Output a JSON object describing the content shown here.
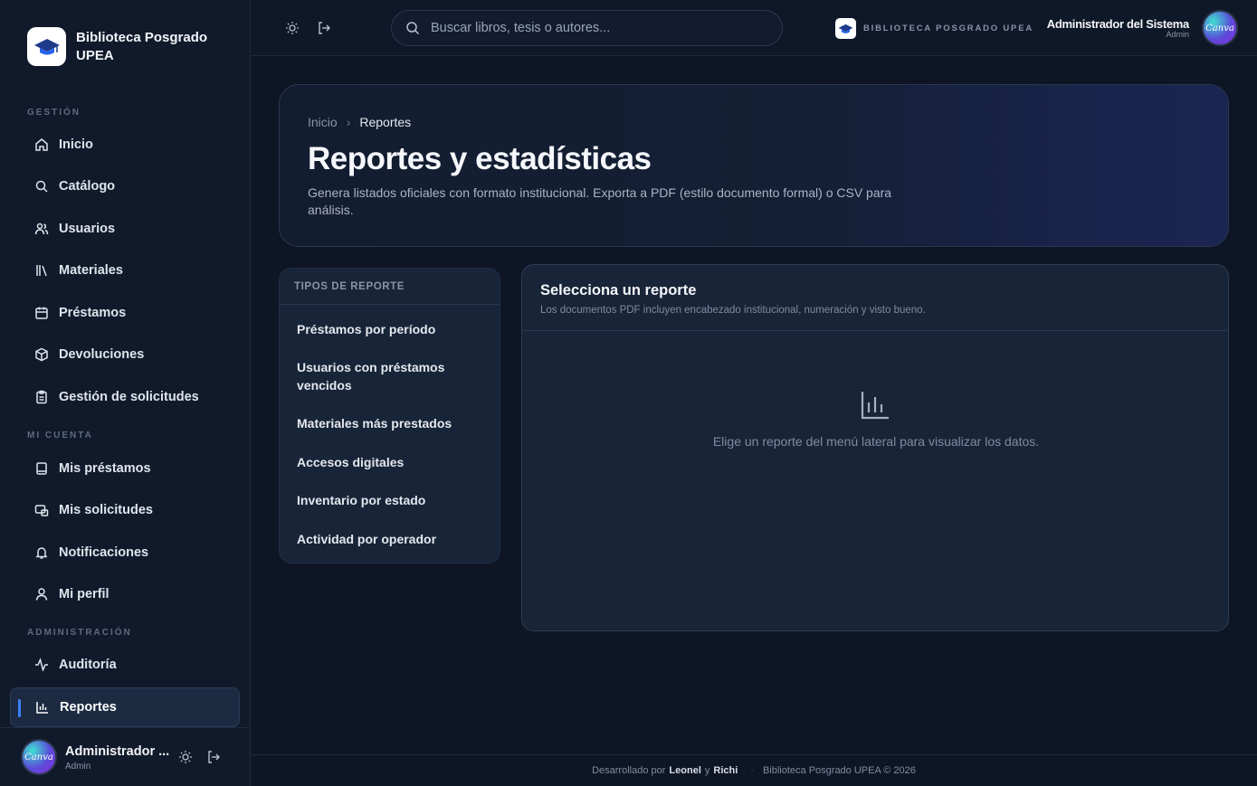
{
  "brand": {
    "name": "Biblioteca Posgrado UPEA"
  },
  "sidebar": {
    "sections": [
      {
        "label": "GESTIÓN"
      },
      {
        "label": "MI CUENTA"
      },
      {
        "label": "ADMINISTRACIÓN"
      }
    ],
    "items": [
      {
        "label": "Inicio",
        "icon": "home-icon"
      },
      {
        "label": "Catálogo",
        "icon": "search-icon"
      },
      {
        "label": "Usuarios",
        "icon": "users-icon"
      },
      {
        "label": "Materiales",
        "icon": "library-icon"
      },
      {
        "label": "Préstamos",
        "icon": "calendar-icon"
      },
      {
        "label": "Devoluciones",
        "icon": "package-icon"
      },
      {
        "label": "Gestión de solicitudes",
        "icon": "clipboard-icon"
      },
      {
        "label": "Mis préstamos",
        "icon": "book-icon"
      },
      {
        "label": "Mis solicitudes",
        "icon": "request-icon"
      },
      {
        "label": "Notificaciones",
        "icon": "bell-icon"
      },
      {
        "label": "Mi perfil",
        "icon": "user-icon"
      },
      {
        "label": "Auditoría",
        "icon": "activity-icon"
      },
      {
        "label": "Reportes",
        "icon": "bar-chart-icon",
        "active": true
      }
    ],
    "footer": {
      "name": "Administrador ...",
      "role": "Admin",
      "avatar_text": "Canva"
    }
  },
  "topbar": {
    "search_placeholder": "Buscar libros, tesis o autores...",
    "brand_text": "BIBLIOTECA POSGRADO UPEA",
    "user_name": "Administrador del Sistema",
    "user_role": "Admin",
    "avatar_text": "Canva"
  },
  "hero": {
    "breadcrumb": [
      "Inicio",
      "Reportes"
    ],
    "title": "Reportes y estadísticas",
    "subtitle": "Genera listados oficiales con formato institucional. Exporta a PDF (estilo documento formal) o CSV para análisis."
  },
  "report_types": {
    "header": "TIPOS DE REPORTE",
    "items": [
      "Préstamos por período",
      "Usuarios con préstamos vencidos",
      "Materiales más prestados",
      "Accesos digitales",
      "Inventario por estado",
      "Actividad por operador"
    ]
  },
  "report_panel": {
    "title": "Selecciona un reporte",
    "subtitle": "Los documentos PDF incluyen encabezado institucional, numeración y visto bueno.",
    "empty_text": "Elige un reporte del menú lateral para visualizar los datos."
  },
  "footer": {
    "prefix": "Desarrollado por",
    "author1": "Leonel",
    "conj": "y",
    "author2": "Richi",
    "copyright": "Biblioteca Posgrado UPEA © 2026"
  },
  "colors": {
    "accent": "#3b82f6",
    "background": "#0e1626",
    "sidebar": "#111a2b"
  }
}
